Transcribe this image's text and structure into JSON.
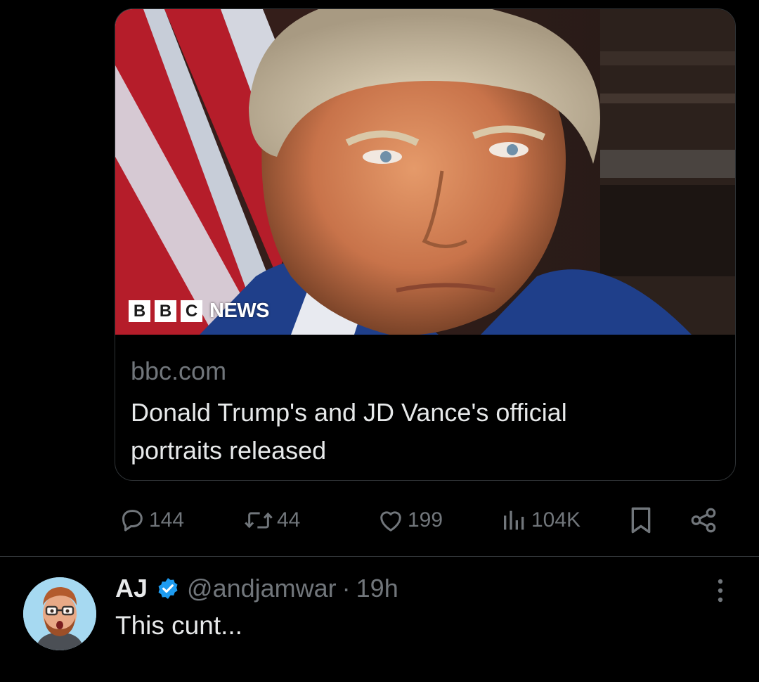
{
  "card": {
    "logo": {
      "letters": [
        "B",
        "B",
        "C"
      ],
      "word": "NEWS"
    },
    "domain": "bbc.com",
    "title_line1": "Donald Trump's and JD Vance's official",
    "title_line2": "portraits released"
  },
  "actions": {
    "replies": "144",
    "reposts": "44",
    "likes": "199",
    "views": "104K"
  },
  "reply": {
    "name": "AJ",
    "handle": "@andjamwar",
    "separator": "·",
    "time": "19h",
    "text": "This cunt..."
  },
  "colors": {
    "background": "#000000",
    "text_primary": "#e7e9ea",
    "text_secondary": "#71767b",
    "border": "#2f3336",
    "verified_blue": "#1d9bf0",
    "avatar_bg": "#a6d9f1"
  }
}
